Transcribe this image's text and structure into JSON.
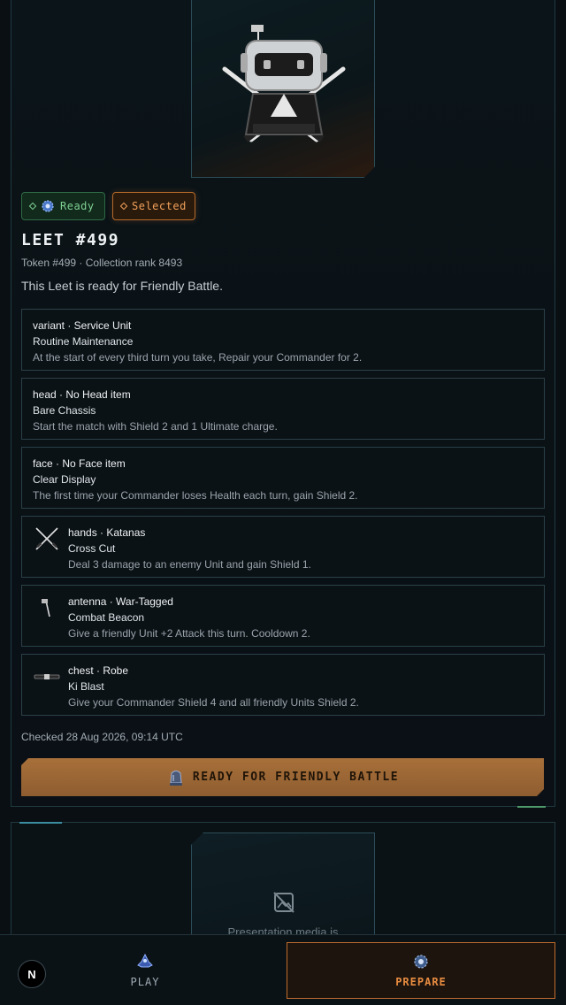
{
  "card": {
    "badges": {
      "ready": "Ready",
      "selected": "Selected"
    },
    "title": "LEET #499",
    "meta": "Token #499 · Collection rank 8493",
    "description": "This Leet is ready for Friendly Battle.",
    "traits": [
      {
        "heading": "variant · Service Unit",
        "ability": "Routine Maintenance",
        "effect": "At the start of every third turn you take, Repair your Commander for 2.",
        "icon": ""
      },
      {
        "heading": "head · No Head item",
        "ability": "Bare Chassis",
        "effect": "Start the match with Shield 2 and 1 Ultimate charge.",
        "icon": ""
      },
      {
        "heading": "face · No Face item",
        "ability": "Clear Display",
        "effect": "The first time your Commander loses Health each turn, gain Shield 2.",
        "icon": ""
      },
      {
        "heading": "hands · Katanas",
        "ability": "Cross Cut",
        "effect": "Deal 3 damage to an enemy Unit and gain Shield 1.",
        "icon": "katanas-icon"
      },
      {
        "heading": "antenna · War-Tagged",
        "ability": "Combat Beacon",
        "effect": "Give a friendly Unit +2 Attack this turn. Cooldown 2.",
        "icon": "antenna-icon"
      },
      {
        "heading": "chest · Robe",
        "ability": "Ki Blast",
        "effect": "Give your Commander Shield 4 and all friendly Units Shield 2.",
        "icon": "robe-icon"
      }
    ],
    "checked": "Checked 28 Aug 2026, 09:14 UTC",
    "cta": "READY FOR FRIENDLY BATTLE"
  },
  "card2": {
    "media_caption": "Presentation media is"
  },
  "nav": {
    "logo": "N",
    "play": "PLAY",
    "prepare": "PREPARE"
  },
  "colors": {
    "accent": "#e88c40",
    "ready": "#7ecf92",
    "cta": "#a8703a"
  }
}
